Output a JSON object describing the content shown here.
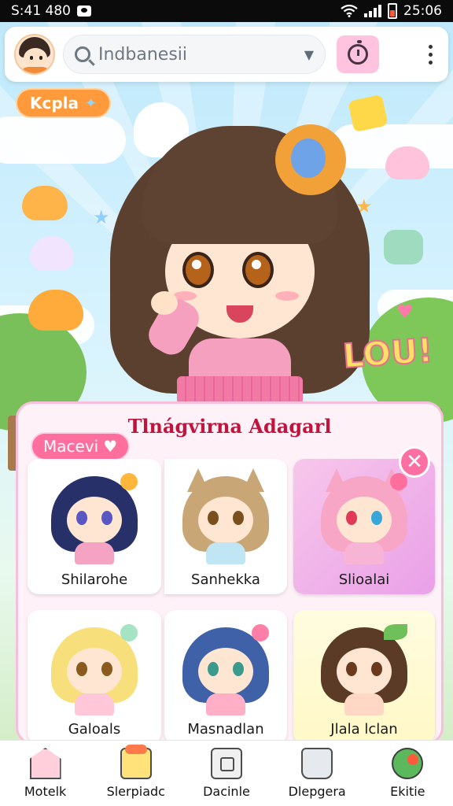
{
  "status_bar": {
    "time_left": "S:41 480",
    "time_right": "25:06"
  },
  "search": {
    "value": "Indbanesii"
  },
  "tag_pill": {
    "label": "Kcpla"
  },
  "hero": {
    "shout_text": "LOU!"
  },
  "panel": {
    "title": "Tlnágvirna Adagarl",
    "mood_pill": "Macevi",
    "characters": [
      {
        "name": "Shilarohe",
        "hair_color": "#273068",
        "eye_color": "#5a56c4",
        "body_color": "#f5a3c2"
      },
      {
        "name": "Sanhekka",
        "hair_color": "#c8a676",
        "eye_color": "#7a4f1e",
        "body_color": "#bfe6f2"
      },
      {
        "name": "Slioalai",
        "hair_color": "#f7a7c5",
        "eye_color": "#e03a58",
        "body_color": "#f7b4d4"
      },
      {
        "name": "Galoals",
        "hair_color": "#f7e07b",
        "eye_color": "#8b5a1f",
        "body_color": "#ffc7d8"
      },
      {
        "name": "Masnadlan",
        "hair_color": "#3f61a8",
        "eye_color": "#3a9b8c",
        "body_color": "#ffb0c7"
      },
      {
        "name": "Jlala lclan",
        "hair_color": "#5b3b26",
        "eye_color": "#6b3a1e",
        "body_color": "#ffd7c4"
      }
    ]
  },
  "bottom_nav": [
    {
      "label": "Motelk",
      "icon": "house-icon"
    },
    {
      "label": "Slerpiadc",
      "icon": "shop-icon"
    },
    {
      "label": "Dacinle",
      "icon": "box-icon"
    },
    {
      "label": "Dlepgera",
      "icon": "mug-icon"
    },
    {
      "label": "Ekitie",
      "icon": "leaf-icon"
    }
  ]
}
